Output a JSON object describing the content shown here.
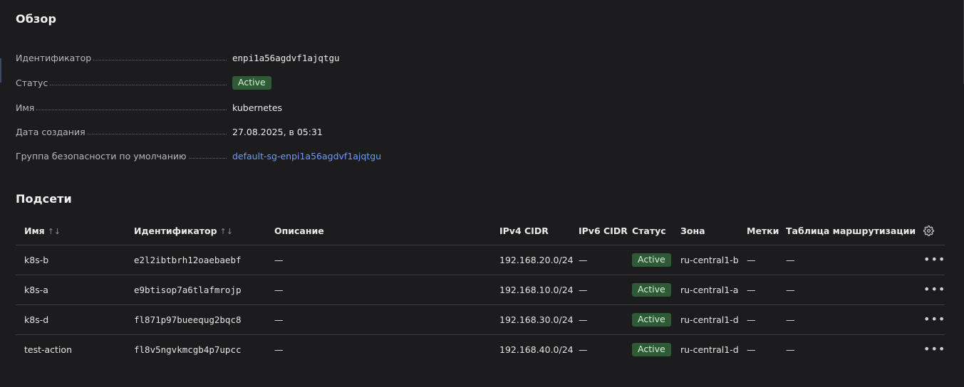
{
  "overview": {
    "title": "Обзор",
    "properties": [
      {
        "label": "Идентификатор",
        "value": "enpi1a56agdvf1ajqtgu"
      },
      {
        "label": "Статус",
        "value": "Active"
      },
      {
        "label": "Имя",
        "value": "kubernetes"
      },
      {
        "label": "Дата создания",
        "value": "27.08.2025, в 05:31"
      },
      {
        "label": "Группа безопасности по умолчанию",
        "value": "default-sg-enpi1a56agdvf1ajqtgu"
      }
    ]
  },
  "subnets": {
    "title": "Подсети",
    "columns": {
      "name": "Имя",
      "id": "Идентификатор",
      "description": "Описание",
      "ipv4": "IPv4 CIDR",
      "ipv6": "IPv6 CIDR",
      "status": "Статус",
      "zone": "Зона",
      "labels": "Метки",
      "route_table": "Таблица маршрутизации"
    },
    "sort_icon": "↑↓",
    "rows": [
      {
        "name": "k8s-b",
        "id": "e2l2ibtbrh12oaebaebf",
        "description": "—",
        "ipv4": "192.168.20.0/24",
        "ipv6": "—",
        "status": "Active",
        "zone": "ru-central1-b",
        "labels": "—",
        "route_table": "—"
      },
      {
        "name": "k8s-a",
        "id": "e9btisop7a6tlafmrojp",
        "description": "—",
        "ipv4": "192.168.10.0/24",
        "ipv6": "—",
        "status": "Active",
        "zone": "ru-central1-a",
        "labels": "—",
        "route_table": "—"
      },
      {
        "name": "k8s-d",
        "id": "fl871p97bueequg2bqc8",
        "description": "—",
        "ipv4": "192.168.30.0/24",
        "ipv6": "—",
        "status": "Active",
        "zone": "ru-central1-d",
        "labels": "—",
        "route_table": "—"
      },
      {
        "name": "test-action",
        "id": "fl8v5ngvkmcgb4p7upcc",
        "description": "—",
        "ipv4": "192.168.40.0/24",
        "ipv6": "—",
        "status": "Active",
        "zone": "ru-central1-d",
        "labels": "—",
        "route_table": "—"
      }
    ]
  },
  "colors": {
    "background": "#1c1c1e",
    "link": "#6b9bff",
    "status_active_bg": "#2f5a36"
  },
  "icons": {
    "settings": "gear-icon",
    "row_actions": "more-horizontal-icon",
    "sort": "sort-icon"
  }
}
